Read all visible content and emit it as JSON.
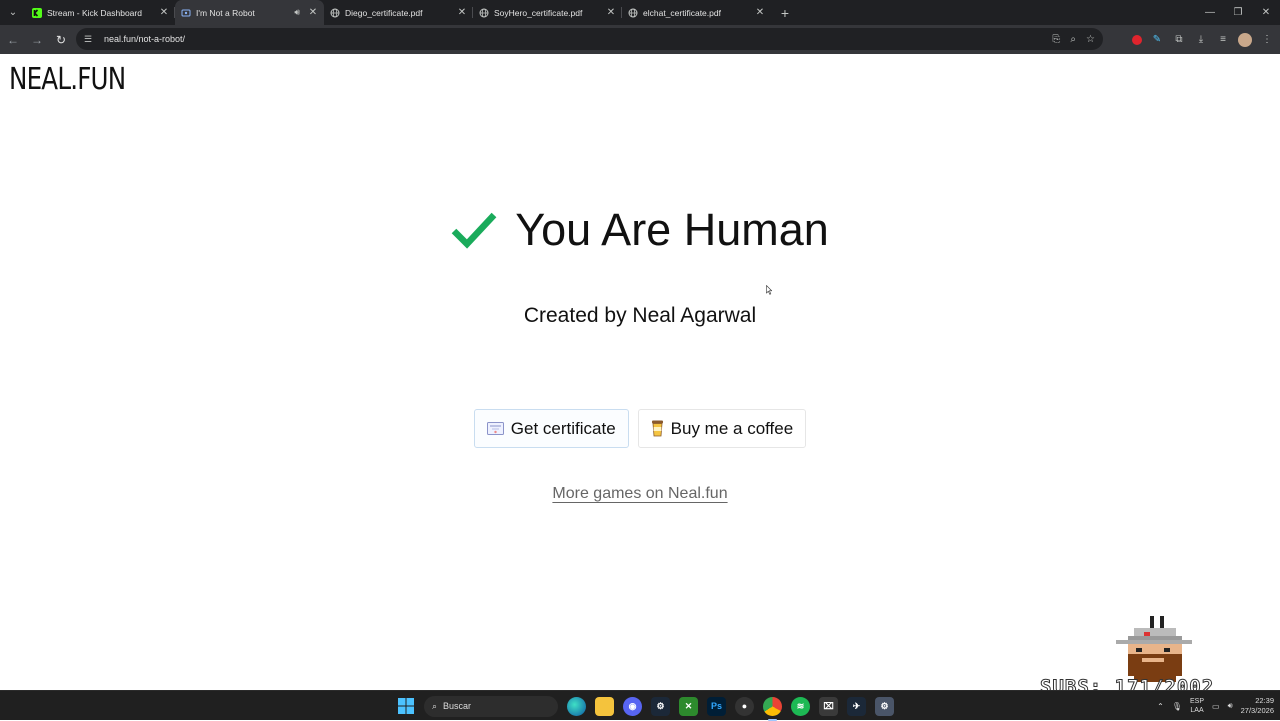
{
  "browser": {
    "tabs": [
      {
        "title": "Stream - Kick Dashboard",
        "icon": "kick-icon",
        "active": false
      },
      {
        "title": "I'm Not a Robot",
        "icon": "neal-fun-icon",
        "active": true,
        "audio": true
      },
      {
        "title": "Diego_certificate.pdf",
        "icon": "globe-icon",
        "active": false
      },
      {
        "title": "SoyHero_certificate.pdf",
        "icon": "globe-icon",
        "active": false
      },
      {
        "title": "elchat_certificate.pdf",
        "icon": "globe-icon",
        "active": false
      }
    ],
    "url": "neal.fun/not-a-robot/"
  },
  "page": {
    "logo": "NEAL.FUN",
    "title": "You Are Human",
    "creator": "Created by Neal Agarwal",
    "cert_button": "Get certificate",
    "coffee_button": "Buy me a coffee",
    "more_link": "More games on Neal.fun"
  },
  "overlay": {
    "subs_text": "SUBS: 171/2002"
  },
  "taskbar": {
    "search_placeholder": "Buscar",
    "lang_top": "ESP",
    "lang_bottom": "LAA",
    "time": "22:39",
    "date": "27/3/2026"
  },
  "colors": {
    "check": "#1aab5b",
    "chrome_dark": "#1f2023",
    "chrome_toolbar": "#35363a"
  }
}
